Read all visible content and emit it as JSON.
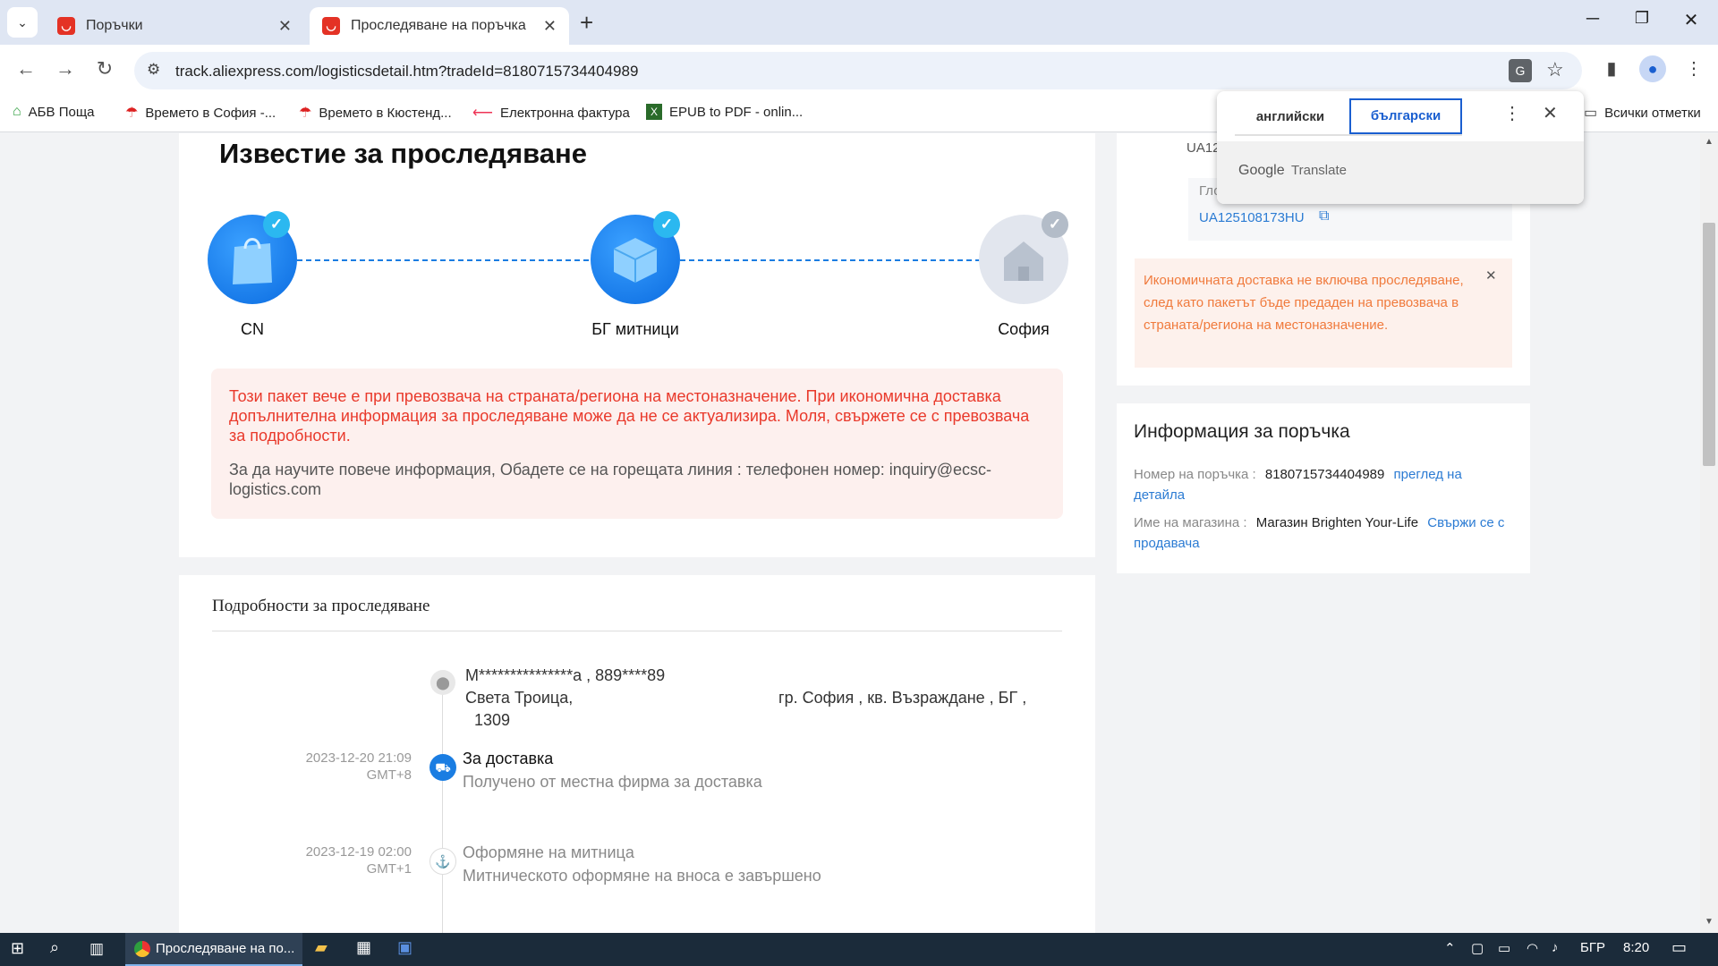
{
  "browser": {
    "tabs": [
      {
        "title": "Поръчки"
      },
      {
        "title": "Проследяване на поръчка"
      }
    ],
    "url": "track.aliexpress.com/logisticsdetail.htm?tradeId=8180715734404989",
    "bookmarks": [
      {
        "label": "АБВ Поща"
      },
      {
        "label": "Времето в София -..."
      },
      {
        "label": "Времето в Кюстенд..."
      },
      {
        "label": "Електронна фактура"
      },
      {
        "label": "EPUB to PDF - onlin..."
      }
    ],
    "all_bookmarks": "Всички отметки"
  },
  "translate": {
    "lang_from": "английски",
    "lang_to": "български",
    "brand_google": "Google",
    "brand_translate": "Translate"
  },
  "notice": {
    "title": "Известие за проследяване",
    "nodes": [
      {
        "label": "CN"
      },
      {
        "label": "БГ митници"
      },
      {
        "label": "София"
      }
    ],
    "alert_red": "Този пакет вече е при превозвача на страната/региона на местоназначение. При икономична доставка допълнителна информация за проследяване може да не се актуализира. Моля, свържете се с превозвача за подробности.",
    "alert_gray": "За да научите повече информация, Обадете се на горещата линия : телефонен номер: inquiry@ecsc-logistics.com"
  },
  "side": {
    "tracking_partial": "UA12",
    "global_label_partial": "Гло",
    "tracking_number": "UA125108173HU",
    "warning": "Икономичната доставка не включва проследяване, след като пакетът бъде предаден на превозвача в страната/региона на местоназначение."
  },
  "order_info": {
    "title": "Информация за поръчка",
    "order_no_label": "Номер на поръчка :",
    "order_no": "8180715734404989",
    "view_detail": "преглед на детайла",
    "store_label": "Име на магазина :",
    "store_name": "Магазин Brighten Your-Life",
    "contact_seller": "Свържи се с продавача"
  },
  "details": {
    "title": "Подробности за проследяване",
    "address_line1": "М***************а ,   889****89",
    "address_line2a": "Света Троица,",
    "address_line2b": "гр. София ,   кв. Възраждане ,   БГ ,",
    "address_line3": "1309",
    "events": [
      {
        "date": "2023-12-20 21:09",
        "tz": "GMT+8",
        "title": "За доставка",
        "sub": "Получено от местна фирма за доставка"
      },
      {
        "date": "2023-12-19 02:00",
        "tz": "GMT+1",
        "title": "Оформяне на митница",
        "sub": "Митническото оформяне на вноса е завършено"
      }
    ]
  },
  "taskbar": {
    "app": "Проследяване на по...",
    "lang": "БГР",
    "time": "8:20"
  }
}
